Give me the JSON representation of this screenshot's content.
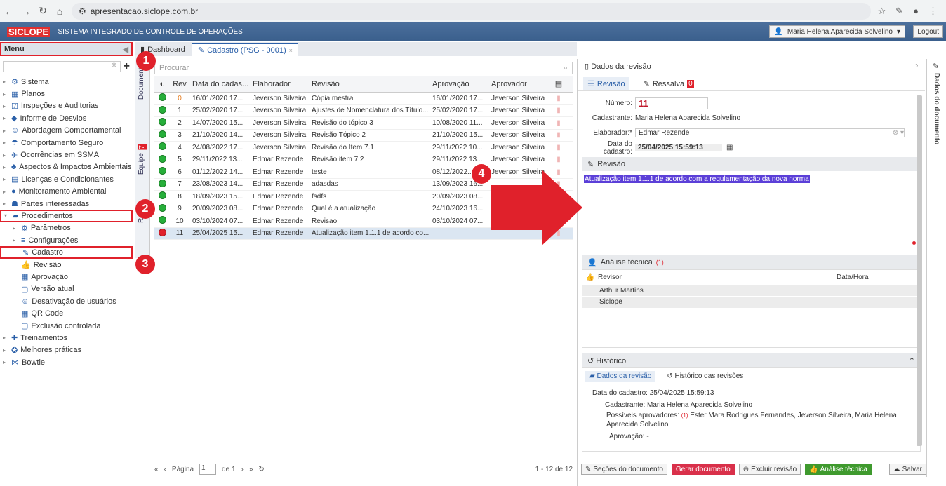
{
  "browser": {
    "url": "apresentacao.siclope.com.br"
  },
  "app": {
    "logo": "SICLOPE",
    "title": "| SISTEMA INTEGRADO DE CONTROLE DE OPERAÇÕES",
    "user": "Maria Helena Aparecida Solvelino",
    "logout": "Logout"
  },
  "menu": {
    "label": "Menu",
    "items": [
      {
        "label": "Sistema",
        "level": 0
      },
      {
        "label": "Planos",
        "level": 0
      },
      {
        "label": "Inspeções e Auditorias",
        "level": 0
      },
      {
        "label": "Informe de Desvios",
        "level": 0
      },
      {
        "label": "Abordagem Comportamental",
        "level": 0
      },
      {
        "label": "Comportamento Seguro",
        "level": 0
      },
      {
        "label": "Ocorrências em SSMA",
        "level": 0
      },
      {
        "label": "Aspectos & Impactos Ambientais",
        "level": 0
      },
      {
        "label": "Licenças e Condicionantes",
        "level": 0
      },
      {
        "label": "Monitoramento Ambiental",
        "level": 0
      },
      {
        "label": "Partes interessadas",
        "level": 0
      },
      {
        "label": "Procedimentos",
        "level": 0,
        "boxed": true
      },
      {
        "label": "Parâmetros",
        "level": 1
      },
      {
        "label": "Configurações",
        "level": 1
      },
      {
        "label": "Cadastro",
        "level": 2,
        "boxed": true
      },
      {
        "label": "Revisão",
        "level": 2
      },
      {
        "label": "Aprovação",
        "level": 2
      },
      {
        "label": "Versão atual",
        "level": 2
      },
      {
        "label": "Desativação de usuários",
        "level": 2
      },
      {
        "label": "QR Code",
        "level": 2
      },
      {
        "label": "Exclusão controlada",
        "level": 2
      },
      {
        "label": "Treinamentos",
        "level": 0
      },
      {
        "label": "Melhores práticas",
        "level": 0
      },
      {
        "label": "Bowtie",
        "level": 0
      }
    ]
  },
  "tabs": {
    "dashboard": "Dashboard",
    "cadastro": "Cadastro (PSG - 0001)"
  },
  "vtabs": {
    "documentos": "Documentos",
    "equipe": "Equipe",
    "equipe_badge": "7",
    "revisao": "Revi"
  },
  "list": {
    "search_placeholder": "Procurar",
    "headers": [
      "Rev",
      "Data do cadas...",
      "Elaborador",
      "Revisão",
      "Aprovação",
      "Aprovador"
    ],
    "rows": [
      [
        "0",
        "16/01/2020 17...",
        "Jeverson Silveira",
        "Cópia mestra",
        "16/01/2020 17...",
        "Jeverson Silveira"
      ],
      [
        "1",
        "25/02/2020 17...",
        "Jeverson Silveira",
        "Ajustes de Nomenclatura dos Título...",
        "25/02/2020 17...",
        "Jeverson Silveira"
      ],
      [
        "2",
        "14/07/2020 15...",
        "Jeverson Silveira",
        "Revisão do tópico 3",
        "10/08/2020 11...",
        "Jeverson Silveira"
      ],
      [
        "3",
        "21/10/2020 14...",
        "Jeverson Silveira",
        "Revisão Tópico 2",
        "21/10/2020 15...",
        "Jeverson Silveira"
      ],
      [
        "4",
        "24/08/2022 17...",
        "Jeverson Silveira",
        "Revisão do Item 7.1",
        "29/11/2022 10...",
        "Jeverson Silveira"
      ],
      [
        "5",
        "29/11/2022 13...",
        "Edmar Rezende",
        "Revisão item 7.2",
        "29/11/2022 13...",
        "Jeverson Silveira"
      ],
      [
        "6",
        "01/12/2022 14...",
        "Edmar Rezende",
        "teste",
        "08/12/2022...",
        "Jeverson Silveira"
      ],
      [
        "7",
        "23/08/2023 14...",
        "Edmar Rezende",
        "adasdas",
        "13/09/2023 16...",
        ""
      ],
      [
        "8",
        "18/09/2023 15...",
        "Edmar Rezende",
        "fsdfs",
        "20/09/2023 08...",
        ""
      ],
      [
        "9",
        "20/09/2023 08...",
        "Edmar Rezende",
        "Qual é a atualização",
        "24/10/2023 16...",
        ""
      ],
      [
        "10",
        "03/10/2024 07...",
        "Edmar Rezende",
        "Revisao",
        "03/10/2024 07...",
        "Maria Helena A..."
      ],
      [
        "11",
        "25/04/2025 15...",
        "Edmar Rezende",
        "Atualização item 1.1.1 de acordo co...",
        "",
        ""
      ]
    ]
  },
  "pager": {
    "page_label": "Página",
    "page": "1",
    "of": "de 1",
    "range": "1 - 12 de 12"
  },
  "detail": {
    "title": "Dados da revisão",
    "tab_revisao": "Revisão",
    "tab_ressalva": "Ressalva",
    "ressalva_badge": "0",
    "numero_label": "Número:",
    "numero": "11",
    "cadastrante_label": "Cadastrante:",
    "cadastrante": "Maria Helena Aparecida Solvelino",
    "elaborador_label": "Elaborador:*",
    "elaborador": "Edmar Rezende",
    "data_label": "Data do cadastro:",
    "data": "25/04/2025 15:59:13",
    "revisao_section": "Revisão",
    "revisao_text": "Atualização item 1.1.1 de acordo com a regulamentação da nova norma",
    "analise_section": "Análise técnica",
    "analise_count": "(1)",
    "revisor_header": "Revisor",
    "datahora_header": "Data/Hora",
    "revisores": [
      "Arthur Martins",
      "Siclope"
    ],
    "historico_section": "Histórico",
    "hist_tab1": "Dados da revisão",
    "hist_tab2": "Histórico das revisões",
    "hist_data": "Data do cadastro: 25/04/2025 15:59:13",
    "hist_cad": "Cadastrante: Maria Helena Aparecida Solvelino",
    "hist_possiveis_label": "Possíveis aprovadores:",
    "hist_possiveis_count": "(1)",
    "hist_possiveis": "Ester Mara Rodrigues Fernandes, Jeverson Silveira, Maria Helena Aparecida Solvelino",
    "hist_aprovacao": "Aprovação: -"
  },
  "buttons": {
    "secoes": "Seções do documento",
    "gerar": "Gerar documento",
    "excluir": "Excluir revisão",
    "analise": "Análise técnica",
    "salvar": "Salvar"
  },
  "side": {
    "label": "Dados do documento"
  },
  "markers": [
    "1",
    "2",
    "3",
    "4"
  ]
}
